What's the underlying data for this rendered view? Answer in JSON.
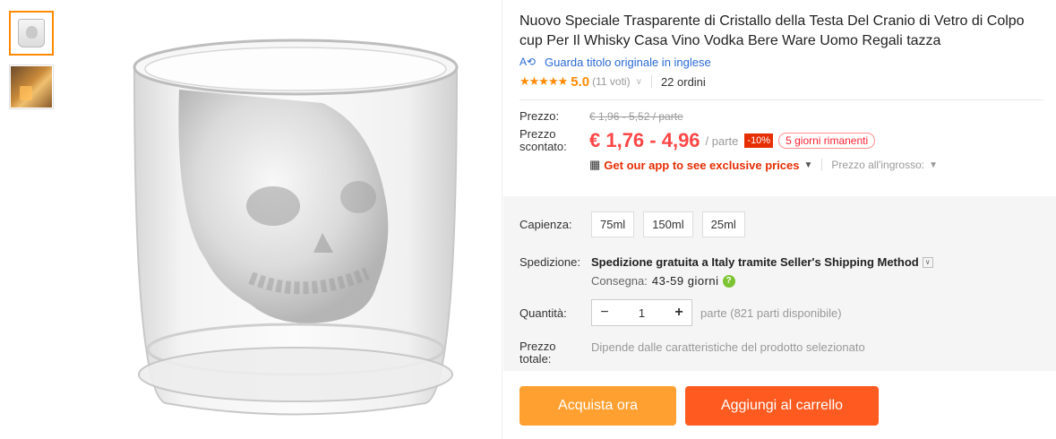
{
  "thumbnails": [
    {
      "alt": "skull glass thumbnail",
      "active": true
    },
    {
      "alt": "pouring drink thumbnail",
      "active": false
    }
  ],
  "product": {
    "title": "Nuovo Speciale Trasparente di Cristallo della Testa Del Cranio di Vetro di Colpo cup Per Il Whisky Casa Vino Vodka Bere Ware Uomo Regali tazza",
    "translate_link": "Guarda titolo originale in inglese",
    "translate_icon": "translate-icon",
    "stars": "★★★★★",
    "rating": "5.0",
    "votes": "(11 voti)",
    "orders": "22 ordini"
  },
  "price": {
    "label": "Prezzo:",
    "old": "€ 1,96 - 5,52 / parte",
    "discount_label": "Prezzo scontato:",
    "current": "€ 1,76 - 4,96",
    "unit": "/ parte",
    "discount_badge": "-10%",
    "days_left": "5 giorni rimanenti",
    "app_link": "Get our app to see exclusive prices",
    "wholesale": "Prezzo all'ingrosso:",
    "accent_color": "#ff4747"
  },
  "options": {
    "capacity_label": "Capienza:",
    "capacities": [
      "75ml",
      "150ml",
      "25ml"
    ],
    "shipping_label": "Spedizione:",
    "shipping_main": "Spedizione gratuita a Italy tramite Seller's Shipping Method",
    "delivery_label": "Consegna:",
    "delivery_days": "43-59 giorni",
    "quantity_label": "Quantità:",
    "quantity_value": "1",
    "quantity_minus": "−",
    "quantity_plus": "+",
    "quantity_note": "parte (821 parti disponibile)",
    "total_label": "Prezzo totale:",
    "total_value": "Dipende dalle caratteristiche del prodotto selezionato"
  },
  "actions": {
    "buy_now": "Acquista ora",
    "add_to_cart": "Aggiungi al carrello"
  }
}
